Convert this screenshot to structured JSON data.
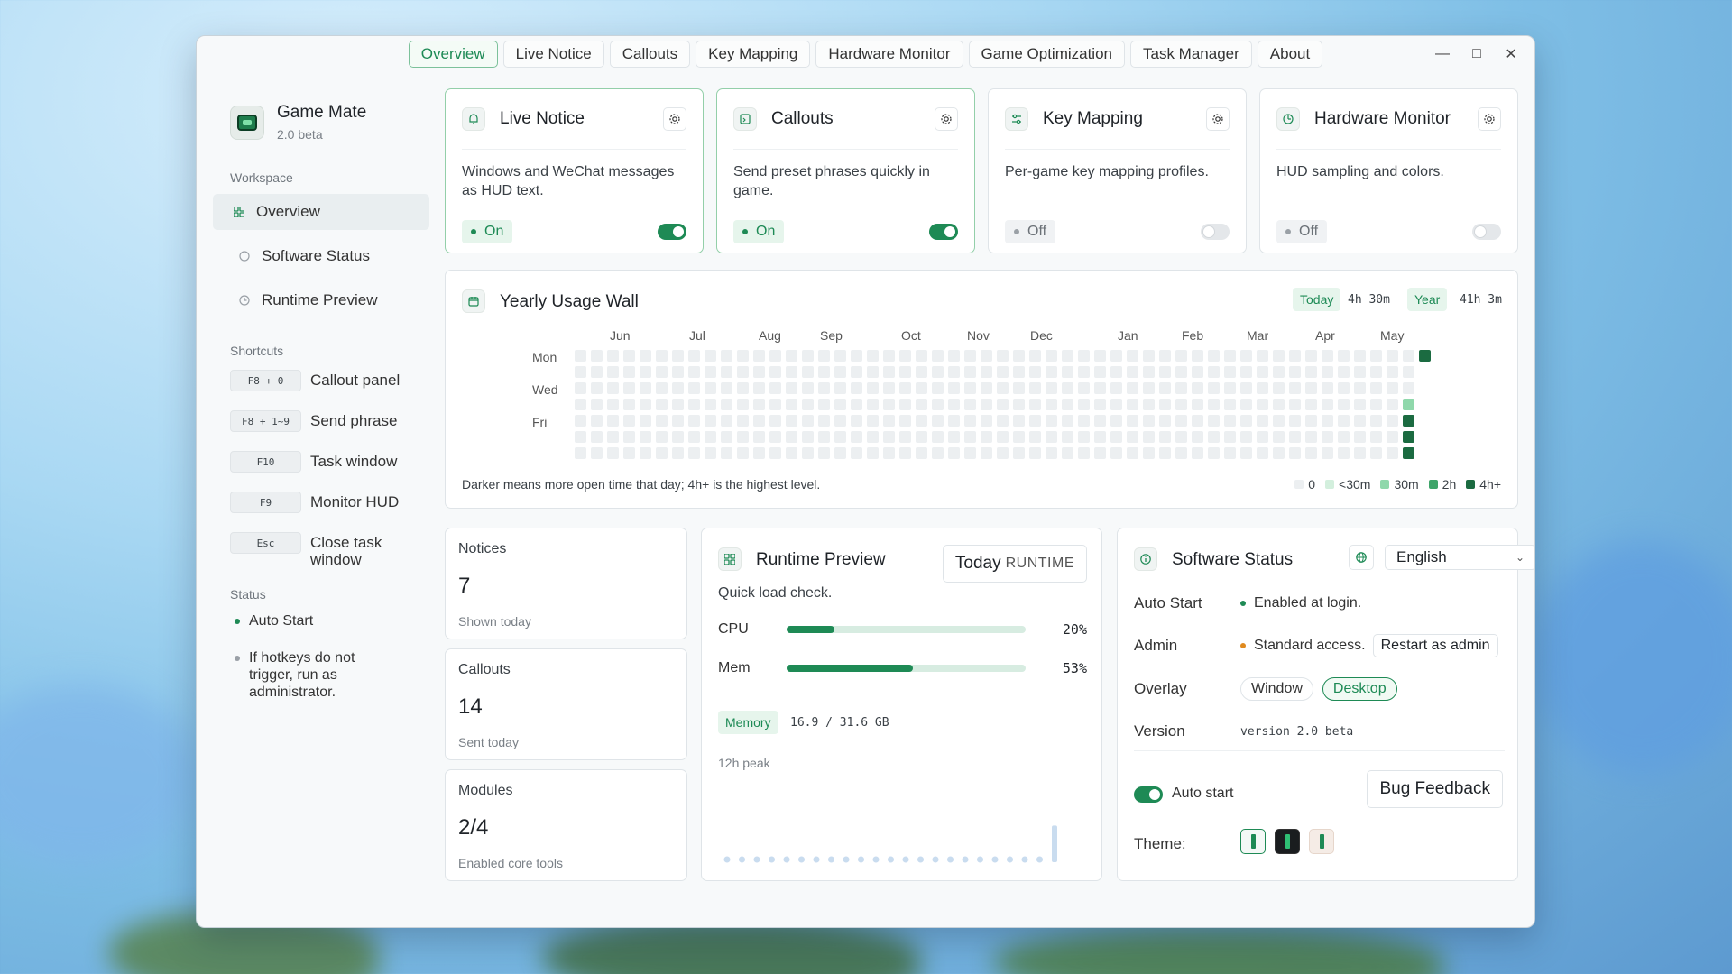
{
  "tabs": [
    "Overview",
    "Live Notice",
    "Callouts",
    "Key Mapping",
    "Hardware Monitor",
    "Game Optimization",
    "Task Manager",
    "About"
  ],
  "window_controls": {
    "minimize": "—",
    "maximize": "□",
    "close": "✕"
  },
  "sidebar": {
    "app_name": "Game Mate",
    "app_version": "2.0 beta",
    "workspace_title": "Workspace",
    "workspace_items": [
      {
        "label": "Overview",
        "icon": "grid-icon"
      },
      {
        "label": "Software Status",
        "icon": "info-icon"
      },
      {
        "label": "Runtime Preview",
        "icon": "clock-icon"
      }
    ],
    "shortcuts_title": "Shortcuts",
    "shortcuts": [
      {
        "key": "F8 + 0",
        "label": "Callout panel"
      },
      {
        "key": "F8 + 1~9",
        "label": "Send phrase"
      },
      {
        "key": "F10",
        "label": "Task window"
      },
      {
        "key": "F9",
        "label": "Monitor HUD"
      },
      {
        "key": "Esc",
        "label": "Close task window"
      }
    ],
    "status_title": "Status",
    "status_items": [
      {
        "text": "Auto Start",
        "color": "#1e8a55"
      },
      {
        "text": "If hotkeys do not trigger, run as administrator.",
        "color": "#9aa0a6"
      }
    ]
  },
  "modules": [
    {
      "title": "Live Notice",
      "desc": "Windows and WeChat messages as HUD text.",
      "state": "On",
      "enabled": true,
      "icon": "bell-icon"
    },
    {
      "title": "Callouts",
      "desc": "Send preset phrases quickly in game.",
      "state": "On",
      "enabled": true,
      "icon": "message-icon"
    },
    {
      "title": "Key Mapping",
      "desc": "Per-game key mapping profiles.",
      "state": "Off",
      "enabled": false,
      "icon": "sliders-icon"
    },
    {
      "title": "Hardware Monitor",
      "desc": "HUD sampling and colors.",
      "state": "Off",
      "enabled": false,
      "icon": "gauge-icon"
    }
  ],
  "usage_wall": {
    "title": "Yearly Usage Wall",
    "today_label": "Today",
    "today_value": "4h 30m",
    "year_label": "Year",
    "year_value": "41h 3m",
    "months": [
      "Jun",
      "Jul",
      "Aug",
      "Sep",
      "Oct",
      "Nov",
      "Dec",
      "Jan",
      "Feb",
      "Mar",
      "Apr",
      "May"
    ],
    "days": [
      "Mon",
      "Wed",
      "Fri"
    ],
    "footnote": "Darker means more open time that day; 4h+ is the highest level.",
    "legend": [
      {
        "label": "0",
        "color": "#eceff1"
      },
      {
        "label": "<30m",
        "color": "#d3efdd"
      },
      {
        "label": "30m",
        "color": "#8fd8ab"
      },
      {
        "label": "2h",
        "color": "#3fa56a"
      },
      {
        "label": "4h+",
        "color": "#1b6b41"
      }
    ],
    "weeks": 53,
    "active_cells": [
      {
        "week": 52,
        "day": 0,
        "level": 4
      },
      {
        "week": 51,
        "day": 3,
        "level": 2
      },
      {
        "week": 51,
        "day": 4,
        "level": 4
      },
      {
        "week": 51,
        "day": 5,
        "level": 4
      },
      {
        "week": 51,
        "day": 6,
        "level": 4
      }
    ],
    "future_cells": [
      1,
      2,
      3,
      4,
      5,
      6
    ]
  },
  "stats": [
    {
      "label": "Notices",
      "value": "7",
      "sub": "Shown today"
    },
    {
      "label": "Callouts",
      "value": "14",
      "sub": "Sent today"
    },
    {
      "label": "Modules",
      "value": "2/4",
      "sub": "Enabled core tools"
    }
  ],
  "runtime": {
    "title": "Runtime Preview",
    "button_main": "Today",
    "button_sub": "RUNTIME",
    "desc": "Quick load check.",
    "bars": [
      {
        "label": "CPU",
        "percent": 20,
        "text": "20%"
      },
      {
        "label": "Mem",
        "percent": 53,
        "text": "53%"
      }
    ],
    "memory_label": "Memory",
    "memory_value": "16.9 / 31.6 GB",
    "peak_label": "12h peak",
    "spark": [
      0,
      0,
      0,
      0,
      0,
      0,
      0,
      0,
      0,
      0,
      0,
      0,
      0,
      0,
      0,
      0,
      0,
      0,
      0,
      0,
      0,
      0,
      0.7,
      0.85
    ]
  },
  "software_status": {
    "title": "Software Status",
    "language": "English",
    "rows": {
      "auto_start_key": "Auto Start",
      "auto_start_val": "Enabled at login.",
      "admin_key": "Admin",
      "admin_val": "Standard access.",
      "admin_btn": "Restart as admin",
      "overlay_key": "Overlay",
      "overlay_opt1": "Window",
      "overlay_opt2": "Desktop",
      "overlay_selected": "Desktop",
      "version_key": "Version",
      "version_val": "version 2.0 beta"
    },
    "auto_start_toggle": "Auto start",
    "auto_start_enabled": true,
    "bug_btn": "Bug Feedback",
    "theme_label": "Theme:",
    "colors": {
      "accent": "#1e8a55",
      "warning": "#e08a1e"
    }
  }
}
